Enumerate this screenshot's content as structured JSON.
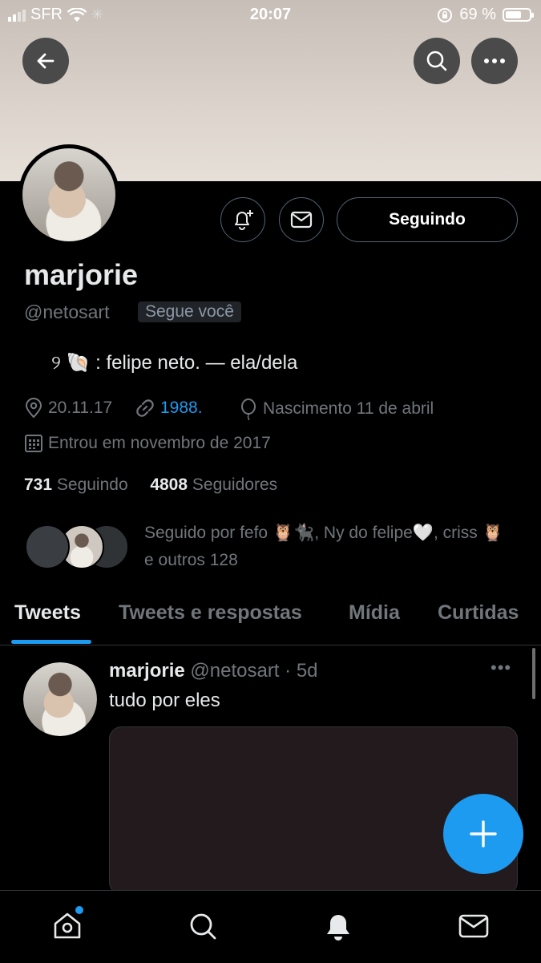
{
  "status_bar": {
    "carrier": "SFR",
    "time": "20:07",
    "battery_percent": "69 %",
    "battery_level": 0.69
  },
  "profile": {
    "display_name": "marjorie",
    "handle": "@netosart",
    "follows_you_badge": "Segue você",
    "follow_button": "Seguindo",
    "bio": "୨ 🐚 : felipe neto. — ela/dela",
    "location": "20.11.17",
    "website": "1988.",
    "birth": "Nascimento 11 de abril",
    "joined": "Entrou em novembro de 2017",
    "following_count": "731",
    "following_label": "Seguindo",
    "followers_count": "4808",
    "followers_label": "Seguidores",
    "followed_by": "Seguido por fefo 🦉🐈‍⬛, Ny do felipe🤍, criss 🦉 e outros 128"
  },
  "tabs": [
    "Tweets",
    "Tweets e respostas",
    "Mídia",
    "Curtidas"
  ],
  "active_tab": "Tweets",
  "tweet": {
    "name": "marjorie",
    "handle": "@netosart",
    "time": "· 5d",
    "text": "tudo por eles",
    "more": "•••"
  },
  "icons": {
    "back": "back-arrow-icon",
    "search": "search-icon",
    "more": "more-icon",
    "notify": "bell-plus-icon",
    "message": "mail-icon",
    "compose": "plus-icon",
    "nav": [
      "home-icon",
      "search-icon",
      "bell-icon",
      "mail-icon"
    ]
  },
  "colors": {
    "accent": "#1d9bf0",
    "background": "#000000",
    "secondary_text": "#71767b"
  }
}
